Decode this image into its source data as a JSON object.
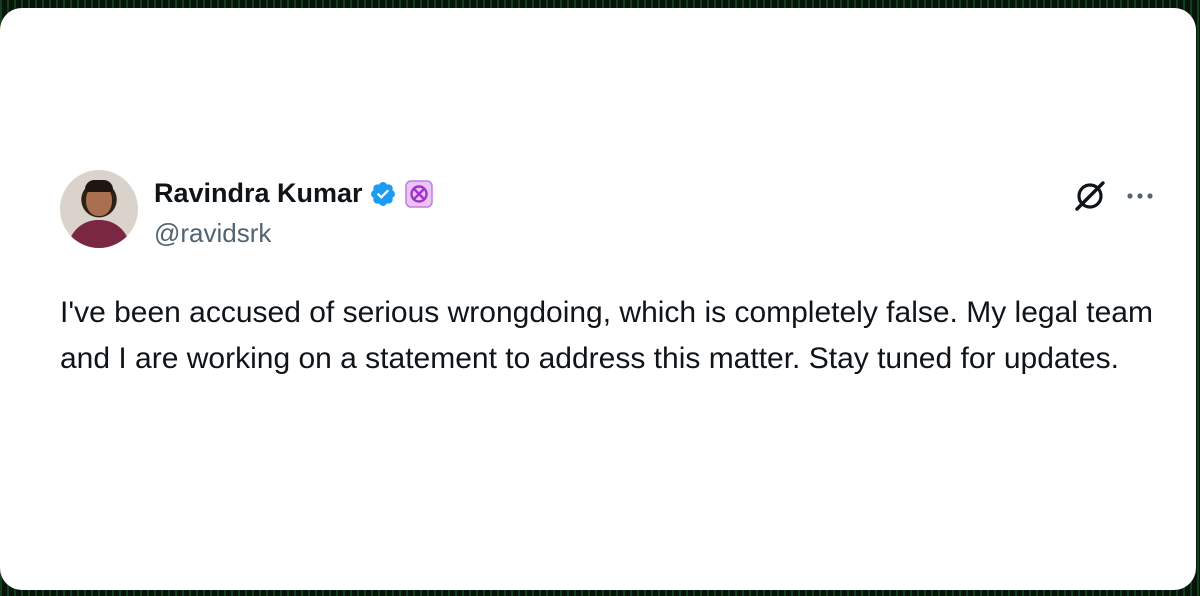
{
  "tweet": {
    "author": {
      "display_name": "Ravindra Kumar",
      "handle": "@ravidsrk",
      "verified": true,
      "badge_icon": "verified-badge-icon",
      "affiliate_icon": "affiliate-badge-icon"
    },
    "text": "I've been accused of serious wrongdoing, which is completely false. My legal team and I are working on a statement to address this matter. Stay tuned for updates.",
    "actions": {
      "grok_icon": "grok-icon",
      "more_icon": "more-options-icon"
    }
  },
  "colors": {
    "card_background": "#ffffff",
    "text_primary": "#0f1419",
    "text_secondary": "#536471",
    "verified_blue": "#1d9bf0",
    "affiliate_purple": "#b23ad6",
    "page_background": "#07140b"
  }
}
